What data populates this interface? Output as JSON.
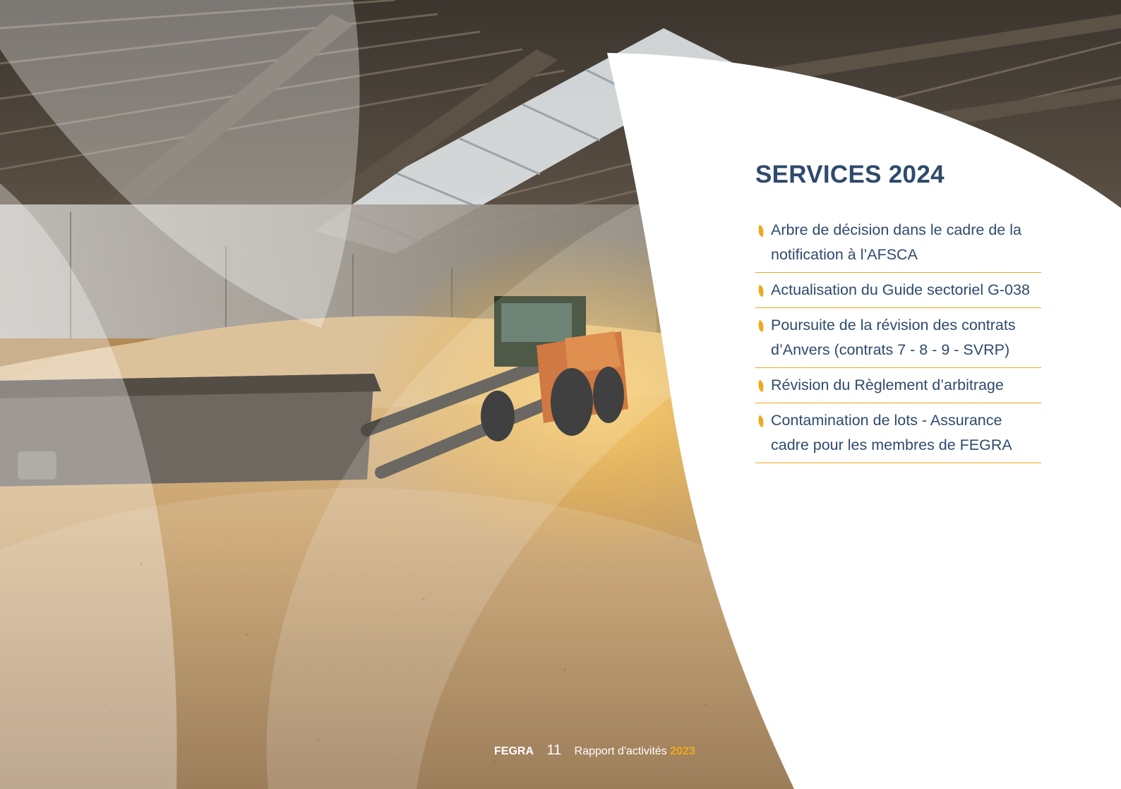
{
  "services": {
    "title": "SERVICES 2024",
    "items": [
      "Arbre de décision dans le cadre de la notification à l’AFSCA",
      "Actualisation du Guide sectoriel G-038",
      "Poursuite de la révision des contrats d’Anvers (contrats 7 - 8 - 9 - SVRP)",
      "Révision du Règlement d’arbitrage",
      "Contamination de lots - Assurance cadre pour les membres de FEGRA"
    ]
  },
  "footer": {
    "brand": "FEGRA",
    "page_number": "11",
    "report_label": "Rapport d'activités",
    "year": "2023"
  },
  "colors": {
    "title_blue": "#2f4a6d",
    "accent_orange": "#f0a81c",
    "grain": "#c49a63"
  },
  "icons": {
    "bullet": "leaf-bullet-icon"
  }
}
